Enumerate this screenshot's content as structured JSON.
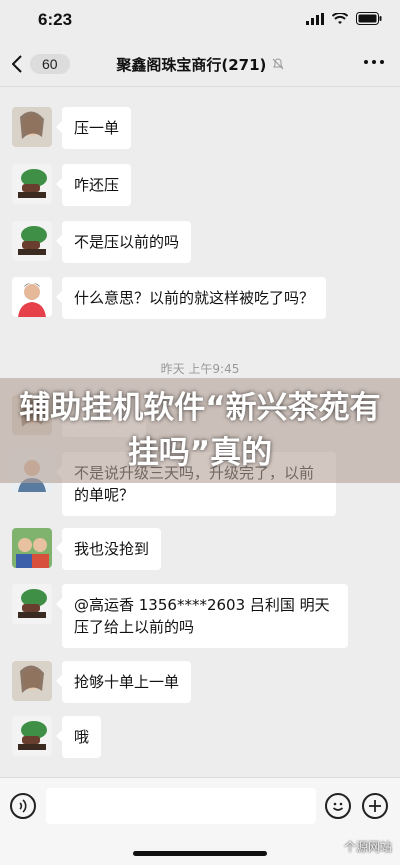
{
  "status_bar": {
    "time": "6:23"
  },
  "nav": {
    "back_count": "60",
    "title": "聚鑫阁珠宝商行(271)"
  },
  "messages": [
    {
      "text": "压一单",
      "avatar": "portrait-a"
    },
    {
      "text": "咋还压",
      "avatar": "tree-b"
    },
    {
      "text": "不是压以前的吗",
      "avatar": "tree-b"
    },
    {
      "text": "什么意思？以前的就这样被吃了吗？",
      "avatar": "person-c"
    },
    {
      "text": "",
      "avatar": "portrait-a"
    },
    {
      "text": "不是说升级三天吗，升级完了，以前的单呢？",
      "avatar": "person-d"
    },
    {
      "text": "我也没抢到",
      "avatar": "kids-e"
    },
    {
      "text": "@高运香 1356****2603 吕利国 明天压了给上以前的吗",
      "avatar": "tree-b"
    },
    {
      "text": "抢够十单上一单",
      "avatar": "portrait-a"
    },
    {
      "text": "哦",
      "avatar": "tree-b"
    }
  ],
  "timestamp": "昨天 上午9:45",
  "banner": {
    "text": "辅助挂机软件“新兴茶苑有挂吗”真的"
  },
  "watermark": "个源网站"
}
